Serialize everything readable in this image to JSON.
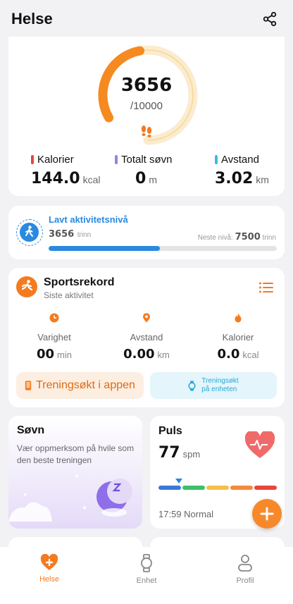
{
  "header": {
    "title": "Helse"
  },
  "steps": {
    "value": "3656",
    "goal": "/10000",
    "progress": 0.3656
  },
  "stats": [
    {
      "label": "Kalorier",
      "value": "144.0",
      "unit": "kcal",
      "color": "#e8453c"
    },
    {
      "label": "Totalt søvn",
      "value": "0",
      "unit": "m",
      "color": "#9b7fe6"
    },
    {
      "label": "Avstand",
      "value": "3.02",
      "unit": "km",
      "color": "#3cb9e8"
    }
  ],
  "activity": {
    "title": "Lavt aktivitetsnivå",
    "steps": "3656",
    "steps_unit": "trinn",
    "next_label": "Neste nivå:",
    "next_value": "7500",
    "next_unit": "trinn",
    "progress": 0.487
  },
  "sport": {
    "title": "Sportsrekord",
    "subtitle": "Siste aktivitet",
    "metrics": [
      {
        "label": "Varighet",
        "value": "00",
        "unit": "min",
        "icon": "clock-icon"
      },
      {
        "label": "Avstand",
        "value": "0.00",
        "unit": "km",
        "icon": "location-pin-icon"
      },
      {
        "label": "Kalorier",
        "value": "0.0",
        "unit": "kcal",
        "icon": "flame-icon"
      }
    ],
    "app_button": "Treningsøkt i appen",
    "device_button_line1": "Treningsøkt",
    "device_button_line2": "på enheten"
  },
  "sleep": {
    "title": "Søvn",
    "description": "Vær oppmerksom på hvile som den beste treningen"
  },
  "pulse": {
    "title": "Puls",
    "value": "77",
    "unit": "spm",
    "time": "17:59 Normal",
    "zone_colors": [
      "#3a7bd5",
      "#3cc06a",
      "#f4c04a",
      "#f48a3c",
      "#e8453c"
    ]
  },
  "tabs": [
    {
      "label": "Helse",
      "icon": "heart-plus-icon",
      "active": true
    },
    {
      "label": "Enhet",
      "icon": "watch-icon",
      "active": false
    },
    {
      "label": "Profil",
      "icon": "person-icon",
      "active": false
    }
  ],
  "colors": {
    "accent": "#f47b20",
    "blue": "#2a89e0"
  }
}
